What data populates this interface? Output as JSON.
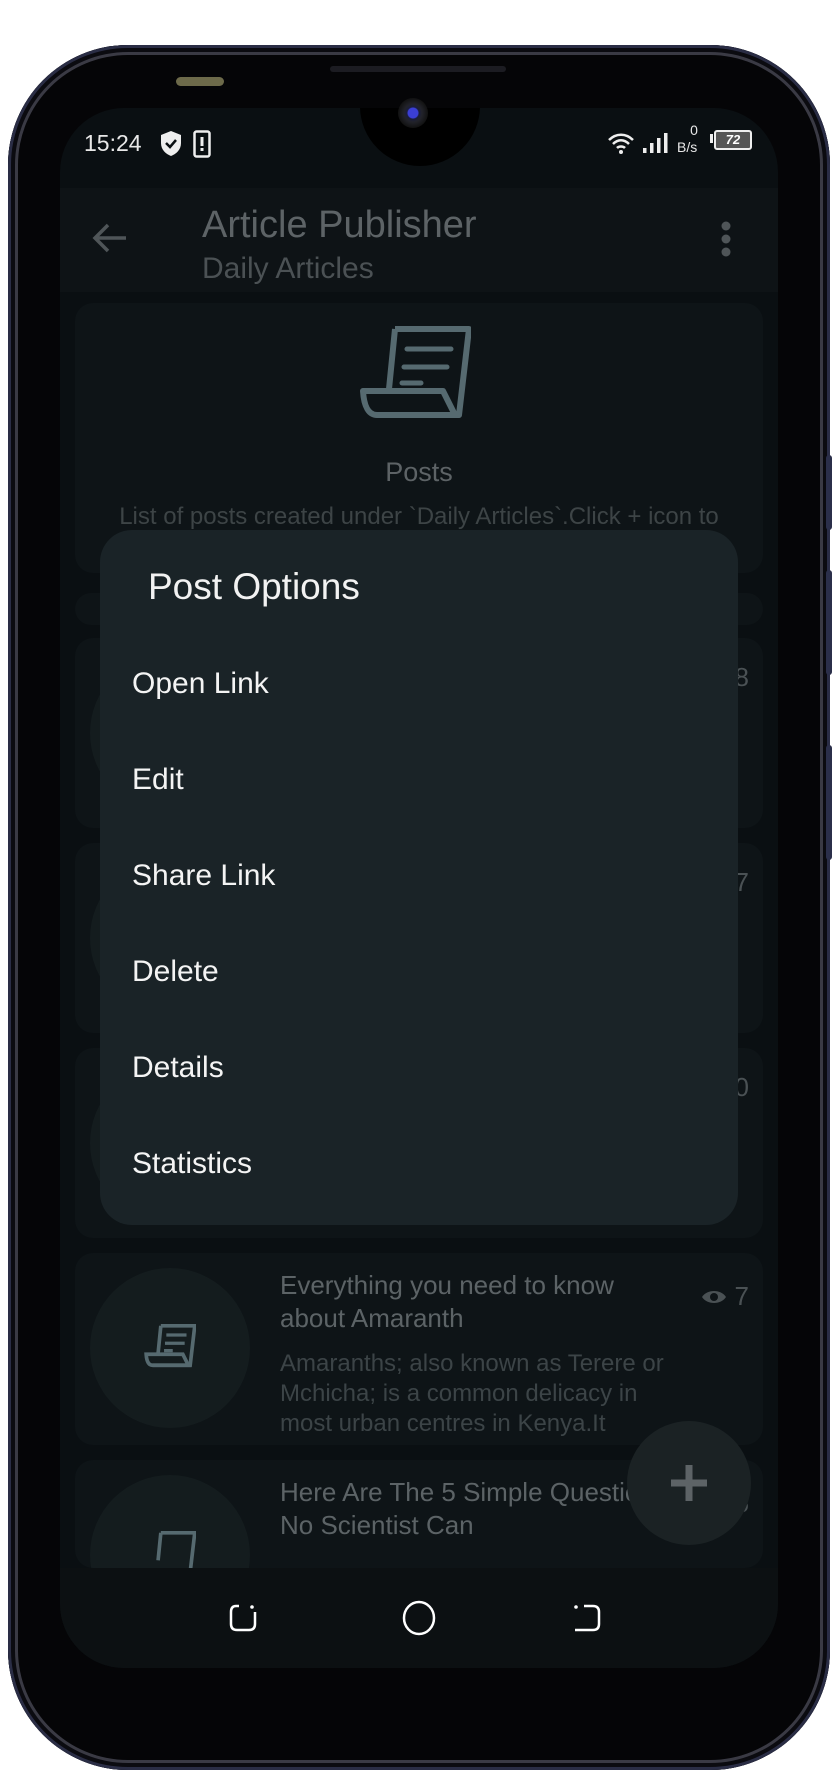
{
  "status_bar": {
    "time": "15:24",
    "network_speed_value": "0",
    "network_speed_unit": "B/s",
    "battery": "72",
    "icons": [
      "shield-check-icon",
      "device-alert-icon",
      "wifi-icon",
      "signal-icon",
      "battery-icon"
    ]
  },
  "app_bar": {
    "title": "Article Publisher",
    "subtitle": "Daily Articles",
    "back_icon": "arrow-left-icon",
    "menu_icon": "more-vert-icon"
  },
  "header_card": {
    "icon": "scroll-document-icon",
    "title": "Posts",
    "description": "List of posts created under `Daily Articles`.Click + icon to"
  },
  "posts": [
    {
      "title": "",
      "description": "",
      "views": "8"
    },
    {
      "title": "",
      "description": "",
      "views": "7"
    },
    {
      "title": "",
      "description": "",
      "views": "0"
    },
    {
      "title": "Everything you need to know about Amaranth",
      "description": "Amaranths; also known as Terere or Mchicha; is a common delicacy in most urban centres in Kenya.It",
      "views": "7"
    },
    {
      "title": "Here Are The 5 Simple Questions No Scientist Can",
      "description": "",
      "views": "5"
    }
  ],
  "fab": {
    "icon": "plus-icon"
  },
  "dialog": {
    "title": "Post Options",
    "items": [
      "Open Link",
      "Edit",
      "Share Link",
      "Delete",
      "Details",
      "Statistics"
    ]
  },
  "nav_bar": {
    "icons": [
      "recents-icon",
      "home-icon",
      "back-icon"
    ]
  }
}
